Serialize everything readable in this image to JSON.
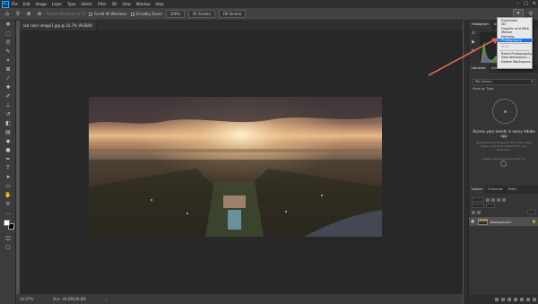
{
  "app": {
    "logo": "Ps"
  },
  "menubar": {
    "items": [
      "File",
      "Edit",
      "Image",
      "Layer",
      "Type",
      "Select",
      "Filter",
      "3D",
      "View",
      "Window",
      "Help"
    ]
  },
  "options_bar": {
    "scroll_all": "Scroll All Windows",
    "scrubby_zoom": "Scrubby Zoom",
    "zoom_100": "100%",
    "fit_screen": "Fit Screen",
    "fill_screen": "Fill Screen",
    "resize_text": "Resize Windows to Fit"
  },
  "document": {
    "tab_title": "lab color image1.jpg @ 16.7% (RGB/8)"
  },
  "status": {
    "zoom": "16.67%",
    "doc_size": "Doc: 49.8M/49.8M"
  },
  "panels": {
    "top_tabs": [
      "Histogram",
      "Navigator"
    ],
    "lib_tabs": [
      "Libraries",
      "Adjustments"
    ],
    "library_select": "My Library",
    "view_by": "View by Type",
    "empty_title": "Access your assets in every Adobe app",
    "empty_desc": "Drag and drop images or add colors, text styles, and other assets from your document.",
    "drag_hint": "Create new shapes from the doc",
    "layers_tabs": [
      "Layers",
      "Channels",
      "Paths"
    ],
    "layer_name": "Background"
  },
  "workspace_menu": {
    "items": [
      "Essentials",
      "3D",
      "Graphic and Web",
      "Motion",
      "Painting",
      "Photography"
    ],
    "selected": "Photography",
    "start": "Start",
    "actions": [
      "Reset Photography",
      "New Workspace...",
      "Delete Workspace..."
    ]
  },
  "colors": {
    "accent": "#1473e6",
    "annotation": "#e0684f"
  }
}
